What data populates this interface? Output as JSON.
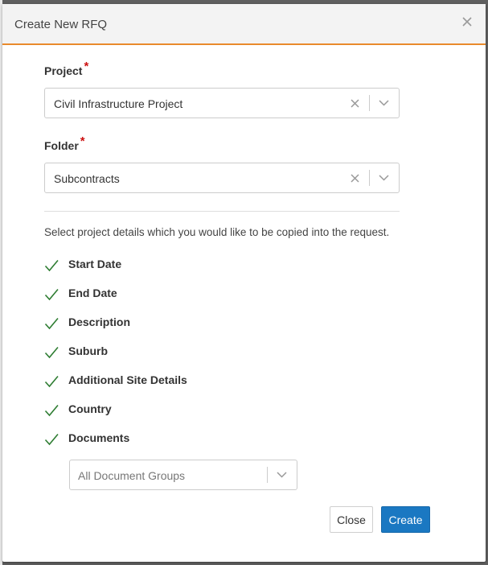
{
  "modal": {
    "title": "Create New RFQ"
  },
  "project": {
    "label": "Project",
    "required_mark": "*",
    "value": "Civil Infrastructure Project"
  },
  "folder": {
    "label": "Folder",
    "required_mark": "*",
    "value": "Subcontracts"
  },
  "details": {
    "help_text": "Select project details which you would like to be copied into the request.",
    "options": [
      {
        "label": "Start Date",
        "checked": true
      },
      {
        "label": "End Date",
        "checked": true
      },
      {
        "label": "Description",
        "checked": true
      },
      {
        "label": "Suburb",
        "checked": true
      },
      {
        "label": "Additional Site Details",
        "checked": true
      },
      {
        "label": "Country",
        "checked": true
      },
      {
        "label": "Documents",
        "checked": true
      }
    ]
  },
  "document_groups": {
    "placeholder": "All Document Groups"
  },
  "footer": {
    "close_label": "Close",
    "create_label": "Create"
  },
  "colors": {
    "accent_orange": "#e98a2c",
    "primary_blue": "#1a78c2",
    "check_green": "#2e7d32",
    "required_red": "#cc1111"
  }
}
